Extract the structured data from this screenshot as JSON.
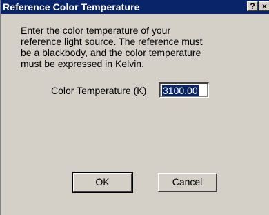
{
  "window": {
    "title": "Reference Color Temperature",
    "help_glyph": "?",
    "close_glyph": "×"
  },
  "description": {
    "lines": [
      "Enter the color temperature of your",
      "reference light source.  The reference must",
      "be a blackbody, and the color temperature",
      "must be expressed in Kelvin."
    ]
  },
  "field": {
    "label": "Color Temperature (K)",
    "value": "3100.00"
  },
  "buttons": {
    "ok": "OK",
    "cancel": "Cancel"
  },
  "colors": {
    "titlebar": "#0a246a",
    "face": "#d4d0c8",
    "selection": "#0a246a"
  }
}
